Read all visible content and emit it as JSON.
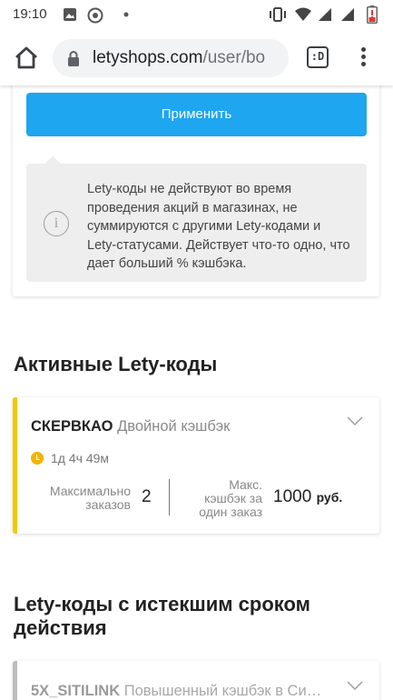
{
  "status_bar": {
    "time": "19:10"
  },
  "browser": {
    "url_domain": "letyshops.com",
    "url_path": "/user/bo",
    "tabs_label": ":D"
  },
  "top_card": {
    "apply_label": "Применить",
    "info_text": "Lety-коды не действуют во время проведения акций в магазинах, не суммируются с другими Lety-кодами и Lety-статусами. Действует что-то одно, что дает больший % кэшбэка."
  },
  "active_section": {
    "title": "Активные Lety-коды",
    "code": {
      "name": "СКЕРВКАО",
      "type": "Двойной кэшбэк",
      "timer": "1д 4ч 49м",
      "max_orders_label": "Максимально заказов",
      "max_orders_value": "2",
      "max_cashback_label": "Макс. кэшбэк за один заказ",
      "max_cashback_value": "1000",
      "currency": "руб."
    }
  },
  "expired_section": {
    "title": "Lety-коды с истекшим сроком действия",
    "code": {
      "name": "5X_SITILINK",
      "type": "Повышенный кэшбэк в Си…"
    }
  },
  "colors": {
    "accent": "#1ea6f0",
    "active_stripe": "#f5c800",
    "expired_stripe": "#bdbdbd"
  }
}
